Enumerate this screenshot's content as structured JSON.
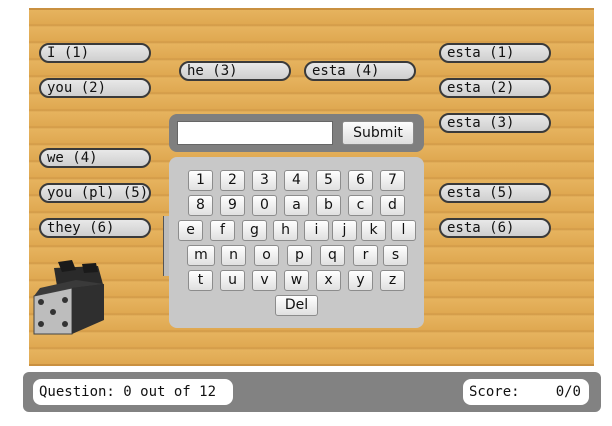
{
  "colors": {
    "board": "#e2ad57",
    "pill": "#d9d9d9",
    "pill_border": "#3a3a3a",
    "keyboard_panel": "#c8c8c8",
    "entry_panel": "#7f7f7f",
    "status_bar": "#828282"
  },
  "pronouns": [
    "I (1)",
    "you (2)",
    "he (3)",
    "we (4)",
    "you (pl) (5)",
    "they (6)"
  ],
  "middle_label": "esta (4)",
  "answers": [
    "esta (1)",
    "esta (2)",
    "esta (3)",
    "esta (5)",
    "esta (6)"
  ],
  "entry": {
    "value": "",
    "submit_label": "Submit"
  },
  "keyboard": {
    "rows": [
      [
        "1",
        "2",
        "3",
        "4",
        "5",
        "6",
        "7"
      ],
      [
        "8",
        "9",
        "0",
        "a",
        "b",
        "c",
        "d"
      ],
      [
        "e",
        "f",
        "g",
        "h",
        "i",
        "j",
        "k",
        "l"
      ],
      [
        "m",
        "n",
        "o",
        "p",
        "q",
        "r",
        "s"
      ],
      [
        "t",
        "u",
        "v",
        "w",
        "x",
        "y",
        "z"
      ]
    ],
    "delete_label": "Del"
  },
  "status": {
    "question_label": "Question:",
    "question_progress": "0 out of 12",
    "score_label": "Score:",
    "score_value": "0/0"
  }
}
